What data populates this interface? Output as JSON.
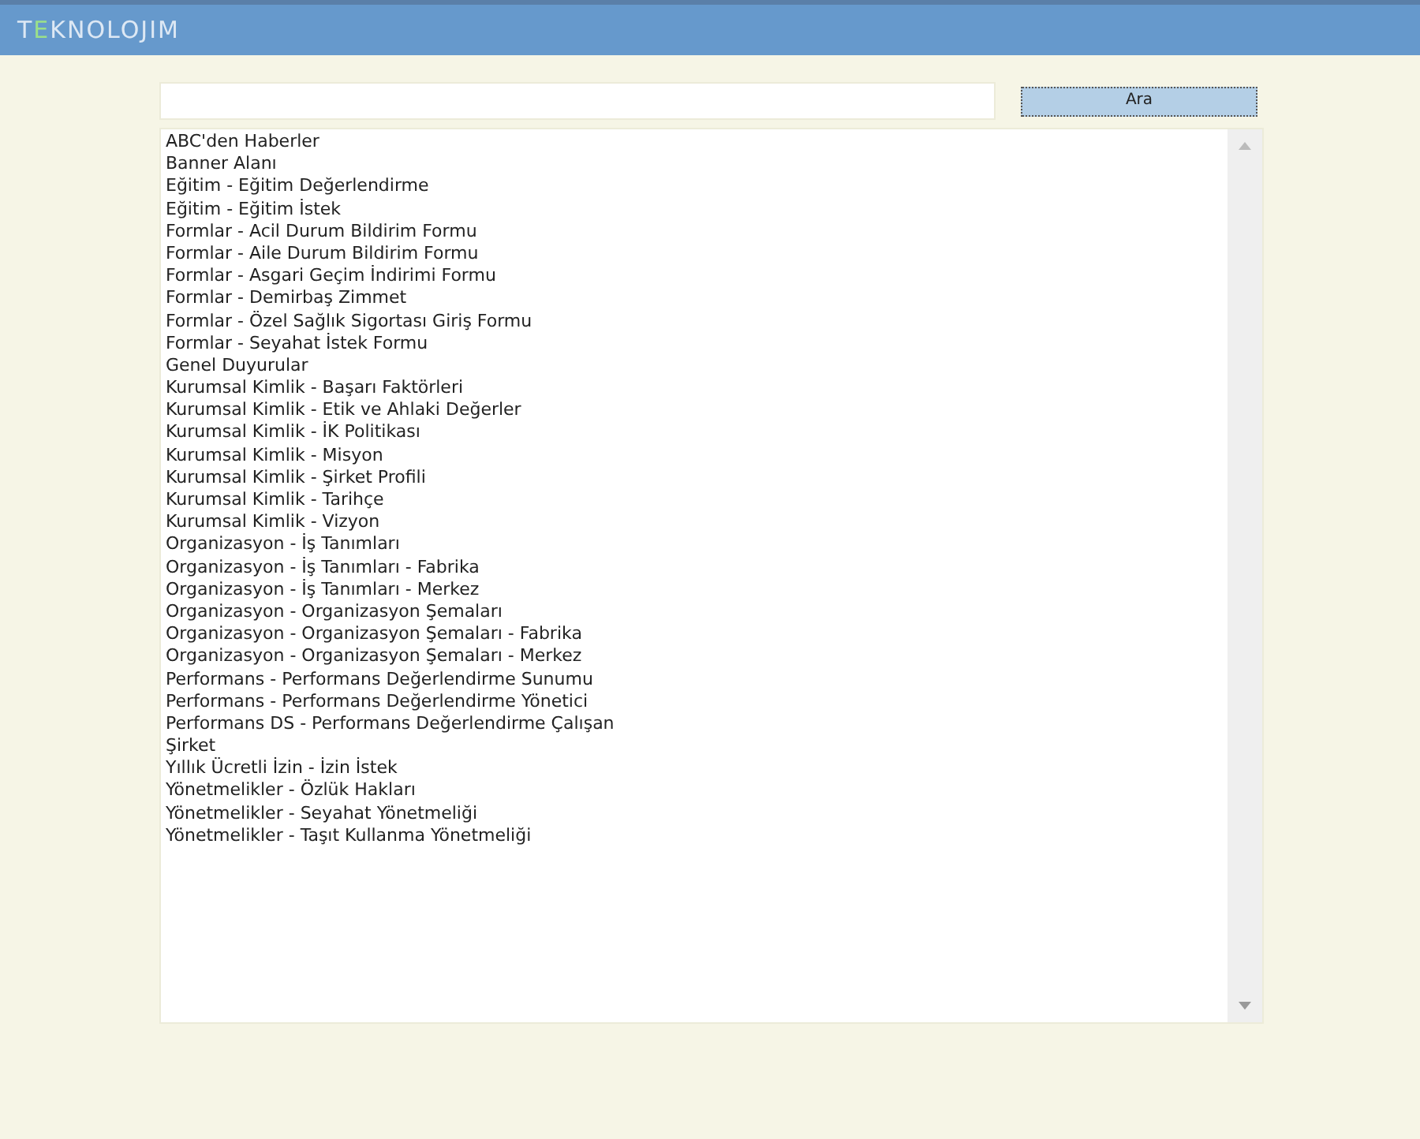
{
  "header": {
    "logo": [
      {
        "text": "T",
        "color": "#dde8f4"
      },
      {
        "text": "E",
        "color": "#9be08a"
      },
      {
        "text": "KNOLOJIM",
        "color": "#dde8f4"
      }
    ]
  },
  "search": {
    "button": "Ara"
  },
  "list": {
    "items": [
      "ABC'den Haberler",
      "Banner Alanı",
      "Eğitim - Eğitim Değerlendirme",
      "Eğitim - Eğitim İstek",
      "Formlar - Acil Durum Bildirim Formu",
      "Formlar - Aile Durum Bildirim Formu",
      "Formlar - Asgari Geçim İndirimi Formu",
      "Formlar - Demirbaş Zimmet",
      "Formlar - Özel Sağlık Sigortası Giriş Formu",
      "Formlar - Seyahat İstek Formu",
      "Genel Duyurular",
      "Kurumsal Kimlik - Başarı Faktörleri",
      "Kurumsal Kimlik - Etik ve Ahlaki Değerler",
      "Kurumsal Kimlik - İK Politikası",
      "Kurumsal Kimlik - Misyon",
      "Kurumsal Kimlik - Şirket Profili",
      "Kurumsal Kimlik - Tarihçe",
      "Kurumsal Kimlik - Vizyon",
      "Organizasyon - İş Tanımları",
      "Organizasyon - İş Tanımları - Fabrika",
      "Organizasyon - İş Tanımları - Merkez",
      "Organizasyon - Organizasyon Şemaları",
      "Organizasyon - Organizasyon Şemaları - Fabrika",
      "Organizasyon - Organizasyon Şemaları - Merkez",
      "Performans - Performans Değerlendirme Sunumu",
      "Performans - Performans Değerlendirme Yönetici",
      "Performans DS - Performans Değerlendirme Çalışan",
      "Şirket",
      "Yıllık Ücretli İzin - İzin İstek",
      "Yönetmelikler - Özlük Hakları",
      "Yönetmelikler - Seyahat Yönetmeliği",
      "Yönetmelikler - Taşıt Kullanma Yönetmeliği"
    ]
  }
}
